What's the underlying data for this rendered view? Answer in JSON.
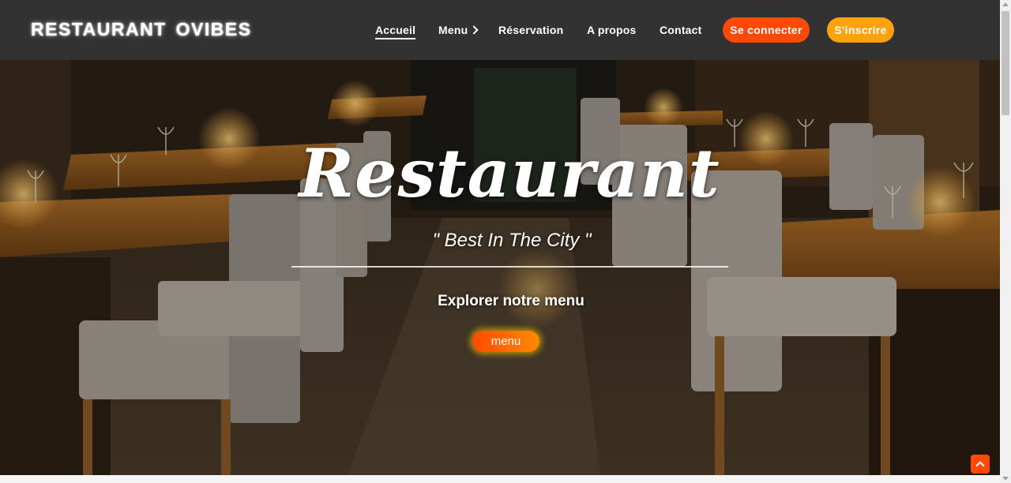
{
  "header": {
    "brand": "RESTAURANT OVIBES",
    "nav": [
      {
        "label": "Accueil",
        "active": true
      },
      {
        "label": "Menu"
      },
      {
        "label": "Réservation"
      },
      {
        "label": "A propos"
      },
      {
        "label": "Contact"
      }
    ],
    "login_label": "Se connecter",
    "signup_label": "S'inscrire"
  },
  "hero": {
    "title": "Restaurant",
    "subtitle": "\" Best In The City \"",
    "explore": "Explorer notre menu",
    "menu_button": "menu"
  },
  "colors": {
    "header_bg": "#323232",
    "accent_orange_red": "#ff4a07",
    "accent_orange": "#ffa20e"
  },
  "icons": {
    "menu_chevron": "chevron-right-icon",
    "back_to_top": "chevron-up-icon"
  }
}
